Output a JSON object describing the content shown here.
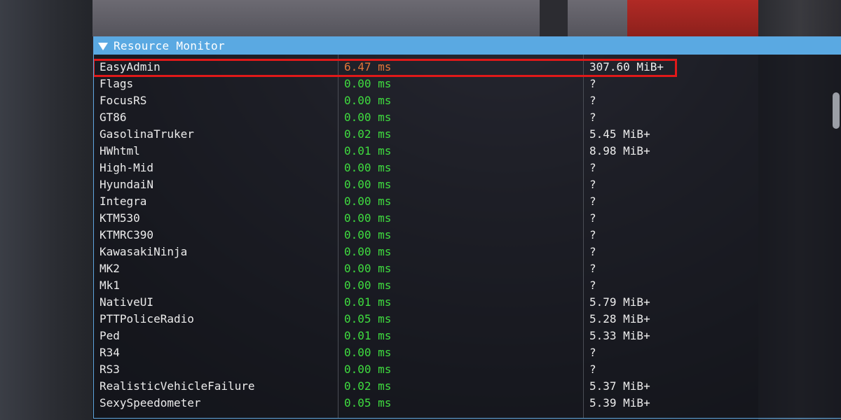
{
  "window": {
    "title": "Resource Monitor"
  },
  "rows": [
    {
      "name": "EasyAdmin",
      "time": "6.47 ms",
      "mem": "307.60 MiB+"
    },
    {
      "name": "Flags",
      "time": "0.00 ms",
      "mem": "?"
    },
    {
      "name": "FocusRS",
      "time": "0.00 ms",
      "mem": "?"
    },
    {
      "name": "GT86",
      "time": "0.00 ms",
      "mem": "?"
    },
    {
      "name": "GasolinaTruker",
      "time": "0.02 ms",
      "mem": "5.45 MiB+"
    },
    {
      "name": "HWhtml",
      "time": "0.01 ms",
      "mem": "8.98 MiB+"
    },
    {
      "name": "High-Mid",
      "time": "0.00 ms",
      "mem": "?"
    },
    {
      "name": "HyundaiN",
      "time": "0.00 ms",
      "mem": "?"
    },
    {
      "name": "Integra",
      "time": "0.00 ms",
      "mem": "?"
    },
    {
      "name": "KTM530",
      "time": "0.00 ms",
      "mem": "?"
    },
    {
      "name": "KTMRC390",
      "time": "0.00 ms",
      "mem": "?"
    },
    {
      "name": "KawasakiNinja",
      "time": "0.00 ms",
      "mem": "?"
    },
    {
      "name": "MK2",
      "time": "0.00 ms",
      "mem": "?"
    },
    {
      "name": "Mk1",
      "time": "0.00 ms",
      "mem": "?"
    },
    {
      "name": "NativeUI",
      "time": "0.01 ms",
      "mem": "5.79 MiB+"
    },
    {
      "name": "PTTPoliceRadio",
      "time": "0.05 ms",
      "mem": "5.28 MiB+"
    },
    {
      "name": "Ped",
      "time": "0.01 ms",
      "mem": "5.33 MiB+"
    },
    {
      "name": "R34",
      "time": "0.00 ms",
      "mem": "?"
    },
    {
      "name": "RS3",
      "time": "0.00 ms",
      "mem": "?"
    },
    {
      "name": "RealisticVehicleFailure",
      "time": "0.02 ms",
      "mem": "5.37 MiB+"
    },
    {
      "name": "SexySpeedometer",
      "time": "0.05 ms",
      "mem": "5.39 MiB+"
    }
  ],
  "colors": {
    "titlebar": "#5aa9e2",
    "time_normal": "#3fdc3f",
    "time_hot": "#e0753a",
    "highlight_border": "#e01919"
  },
  "icons": {
    "collapse": "triangle-down-icon"
  }
}
